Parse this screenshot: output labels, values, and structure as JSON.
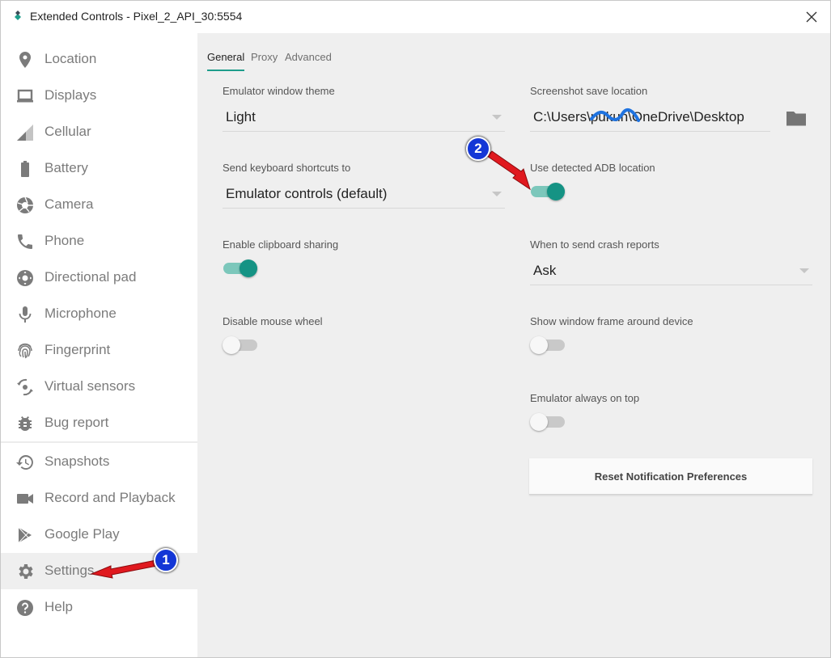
{
  "window": {
    "title": "Extended Controls - Pixel_2_API_30:5554"
  },
  "sidebar": {
    "items": [
      {
        "label": "Location",
        "icon": "location-pin-icon"
      },
      {
        "label": "Displays",
        "icon": "display-icon"
      },
      {
        "label": "Cellular",
        "icon": "cellular-signal-icon"
      },
      {
        "label": "Battery",
        "icon": "battery-icon"
      },
      {
        "label": "Camera",
        "icon": "camera-aperture-icon"
      },
      {
        "label": "Phone",
        "icon": "phone-icon"
      },
      {
        "label": "Directional pad",
        "icon": "dpad-icon"
      },
      {
        "label": "Microphone",
        "icon": "microphone-icon"
      },
      {
        "label": "Fingerprint",
        "icon": "fingerprint-icon"
      },
      {
        "label": "Virtual sensors",
        "icon": "virtual-sensors-icon"
      },
      {
        "label": "Bug report",
        "icon": "bug-icon"
      },
      {
        "label": "Snapshots",
        "icon": "history-icon"
      },
      {
        "label": "Record and Playback",
        "icon": "video-camera-icon"
      },
      {
        "label": "Google Play",
        "icon": "play-store-icon"
      },
      {
        "label": "Settings",
        "icon": "gear-icon",
        "selected": true
      },
      {
        "label": "Help",
        "icon": "help-icon"
      }
    ]
  },
  "tabs": [
    {
      "label": "General",
      "active": true
    },
    {
      "label": "Proxy"
    },
    {
      "label": "Advanced"
    }
  ],
  "settings": {
    "theme": {
      "label": "Emulator window theme",
      "value": "Light"
    },
    "shortcuts": {
      "label": "Send keyboard shortcuts to",
      "value": "Emulator controls (default)"
    },
    "clipboard": {
      "label": "Enable clipboard sharing",
      "on": true
    },
    "mouse_wheel": {
      "label": "Disable mouse wheel",
      "on": false
    },
    "screenshot": {
      "label": "Screenshot save location",
      "value": "C:\\Users\\pukun\\OneDrive\\Desktop"
    },
    "adb": {
      "label": "Use detected ADB location",
      "on": true
    },
    "crash": {
      "label": "When to send crash reports",
      "value": "Ask"
    },
    "frame": {
      "label": "Show window frame around device",
      "on": false
    },
    "on_top": {
      "label": "Emulator always on top",
      "on": false
    },
    "reset_button": "Reset Notification Preferences"
  },
  "annotations": {
    "badge1": "1",
    "badge2": "2"
  },
  "colors": {
    "accent": "#159384",
    "icon_gray": "#7b7b7b",
    "annotation_blue": "#1437d6",
    "annotation_red": "#e0191f"
  }
}
